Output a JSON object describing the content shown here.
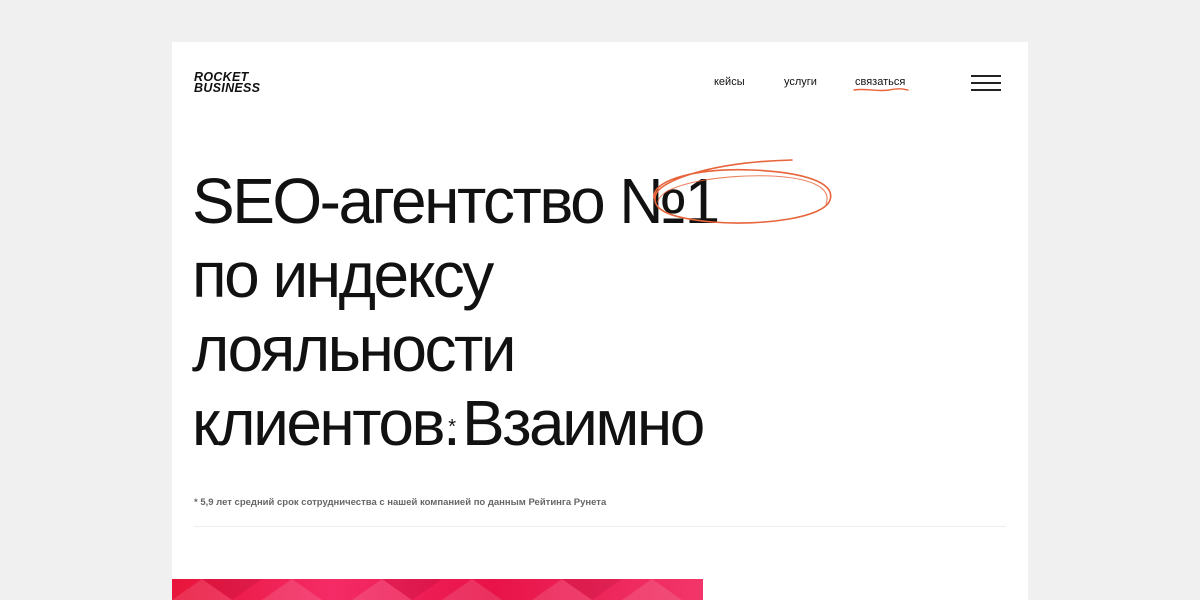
{
  "logo": {
    "line1": "ROCKET",
    "line2": "BUSINESS"
  },
  "nav": {
    "cases": "кейсы",
    "services": "услуги",
    "contact": "связаться"
  },
  "hero": {
    "line1": "SEO-агентство №1",
    "line2": "по индексу",
    "line3": "лояльности",
    "line4_a": "клиентов.",
    "line4_mark": "*",
    "line4_b": "Взаимно"
  },
  "footnote": "* 5,9 лет средний срок сотрудничества с нашей компанией по данным Рейтинга Рунета",
  "colors": {
    "accent": "#e8643a",
    "banner": "#ef1f52",
    "background": "#f0f0f0",
    "page": "#ffffff"
  }
}
